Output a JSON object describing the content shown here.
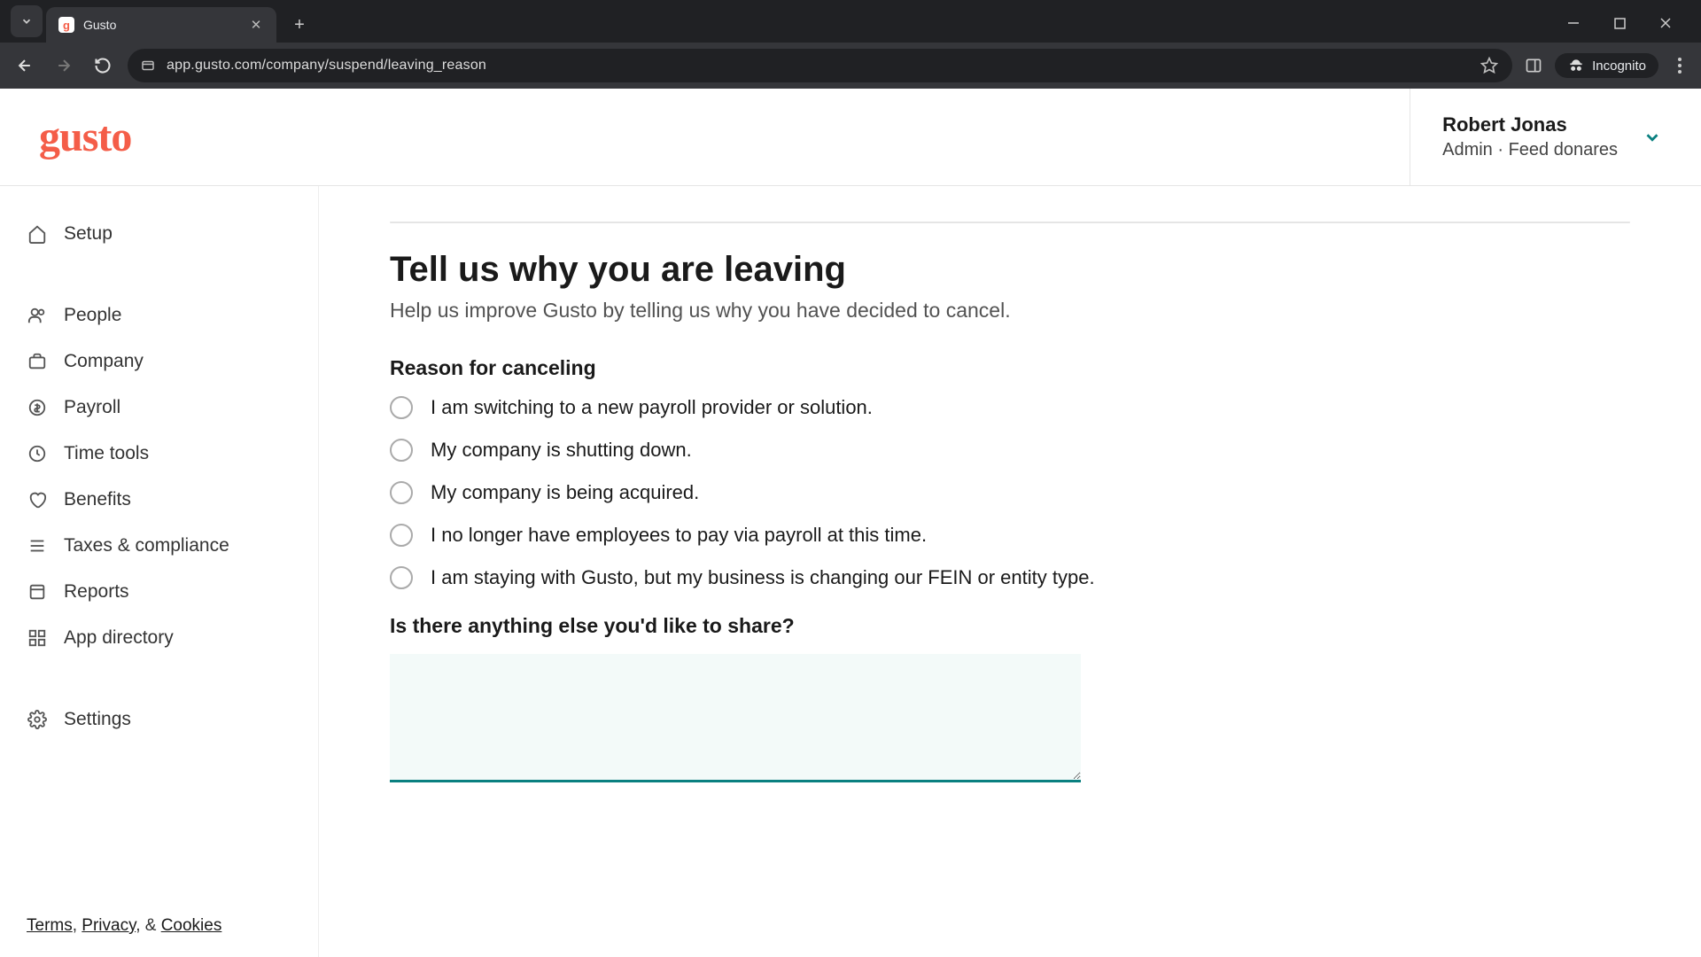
{
  "browser": {
    "tab_title": "Gusto",
    "url": "app.gusto.com/company/suspend/leaving_reason",
    "incognito_label": "Incognito"
  },
  "header": {
    "logo_text": "gusto",
    "user_name": "Robert Jonas",
    "user_role_company": "Admin · Feed donares"
  },
  "sidebar": {
    "items": [
      {
        "label": "Setup"
      },
      {
        "label": "People"
      },
      {
        "label": "Company"
      },
      {
        "label": "Payroll"
      },
      {
        "label": "Time tools"
      },
      {
        "label": "Benefits"
      },
      {
        "label": "Taxes & compliance"
      },
      {
        "label": "Reports"
      },
      {
        "label": "App directory"
      },
      {
        "label": "Settings"
      }
    ],
    "footer": {
      "terms": "Terms",
      "privacy": "Privacy",
      "cookies": "Cookies",
      "sep1": ", ",
      "sep2": ", & "
    }
  },
  "main": {
    "title": "Tell us why you are leaving",
    "subtitle": "Help us improve Gusto by telling us why you have decided to cancel.",
    "reason_label": "Reason for canceling",
    "reasons": [
      "I am switching to a new payroll provider or solution.",
      "My company is shutting down.",
      "My company is being acquired.",
      "I no longer have employees to pay via payroll at this time.",
      "I am staying with Gusto, but my business is changing our FEIN or entity type."
    ],
    "share_label": "Is there anything else you'd like to share?",
    "share_value": ""
  }
}
